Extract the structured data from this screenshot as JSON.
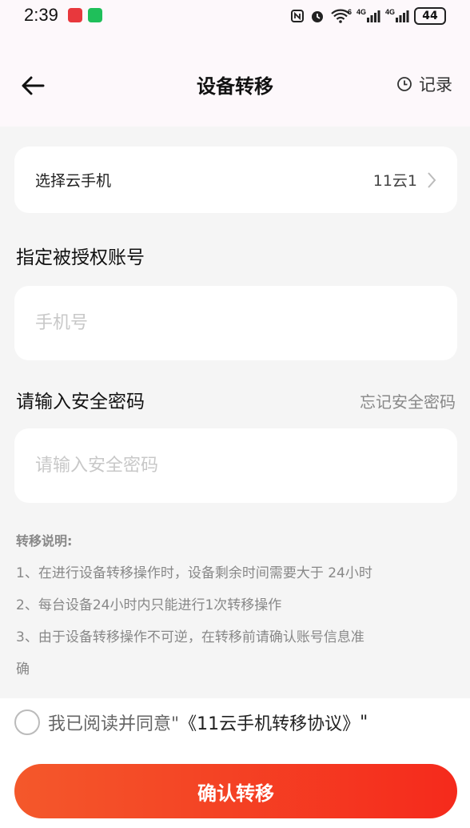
{
  "status_bar": {
    "time": "2:39",
    "signal_1": "4G",
    "signal_2": "4G",
    "wifi_badge": "6",
    "battery": "44"
  },
  "header": {
    "title": "设备转移",
    "records_label": "记录"
  },
  "select_phone": {
    "label": "选择云手机",
    "value": "11云1"
  },
  "account": {
    "label": "指定被授权账号",
    "placeholder": "手机号"
  },
  "password": {
    "label": "请输入安全密码",
    "forgot_label": "忘记安全密码",
    "placeholder": "请输入安全密码"
  },
  "notes": {
    "title": "转移说明:",
    "lines": [
      "1、在进行设备转移操作时，设备剩余时间需要大于 24小时",
      "2、每台设备24小时内只能进行1次转移操作",
      "3、由于设备转移操作不可逆，在转移前请确认账号信息准",
      "确"
    ]
  },
  "agreement": {
    "prefix": "我已阅读并同意\"",
    "link": "《11云手机转移协议》",
    "suffix": "\""
  },
  "confirm_button": "确认转移",
  "colors": {
    "accent_start": "#f4582b",
    "accent_end": "#f52a1c",
    "background": "#f5f5f5"
  }
}
